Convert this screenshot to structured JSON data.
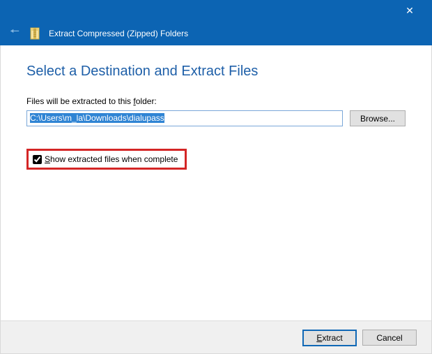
{
  "window": {
    "title": "Extract Compressed (Zipped) Folders"
  },
  "main": {
    "heading": "Select a Destination and Extract Files",
    "dest_label_prefix": "Files will be extracted to this ",
    "dest_label_access": "f",
    "dest_label_suffix": "older:",
    "dest_value": "C:\\Users\\m_la\\Downloads\\dialupass",
    "browse_label": "Browse...",
    "checkbox_access": "S",
    "checkbox_suffix": "how extracted files when complete",
    "checkbox_checked": true
  },
  "footer": {
    "extract_access": "E",
    "extract_suffix": "xtract",
    "cancel_label": "Cancel"
  }
}
